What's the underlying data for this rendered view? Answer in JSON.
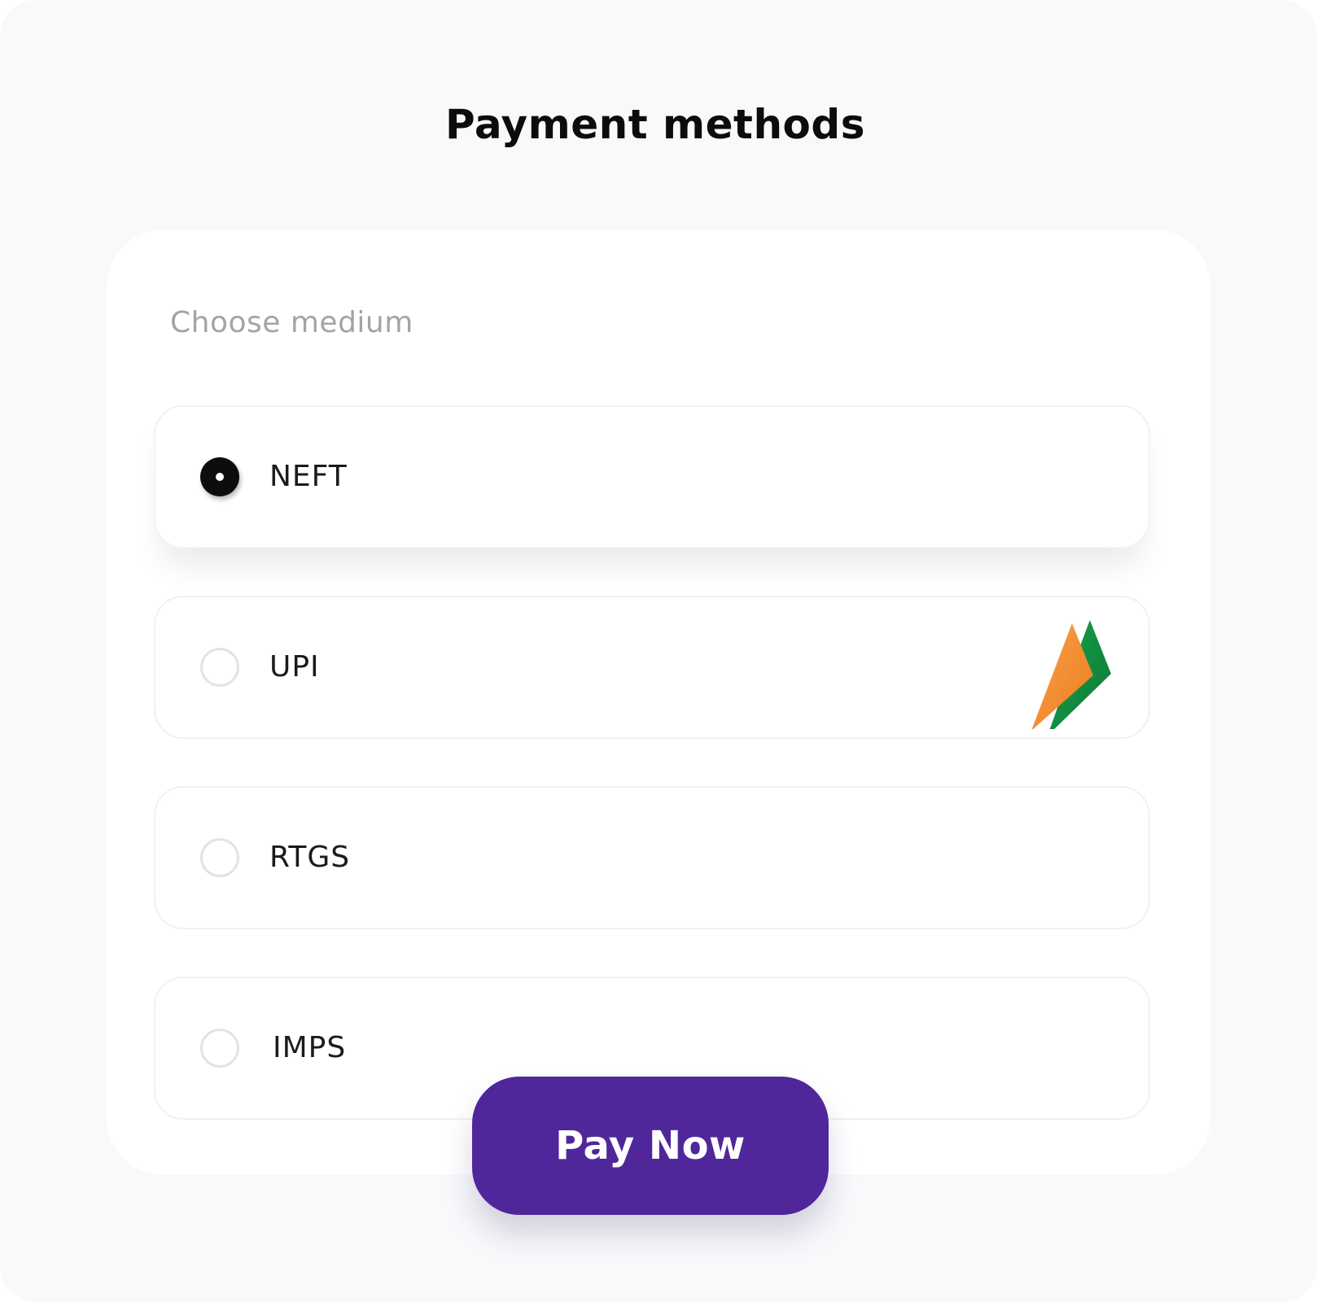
{
  "header": {
    "title": "Payment methods"
  },
  "form": {
    "subtitle": "Choose medium",
    "selected_option": "NEFT",
    "options": [
      {
        "label": "NEFT",
        "selected": true
      },
      {
        "label": "UPI",
        "selected": false,
        "icon": "upi-logo-icon"
      },
      {
        "label": "RTGS",
        "selected": false
      },
      {
        "label": "IMPS",
        "selected": false
      }
    ]
  },
  "actions": {
    "pay_label": "Pay Now"
  },
  "colors": {
    "accent": "#50279a",
    "radio_checked": "#0d0d0d",
    "radio_unchecked_border": "#e3e3e3",
    "upi_orange": "#f58220",
    "upi_green": "#0a8a3c"
  }
}
